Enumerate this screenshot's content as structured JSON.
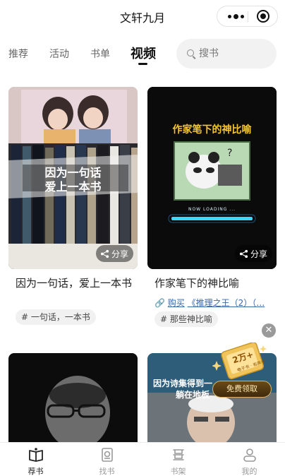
{
  "app": {
    "title": "文轩九月"
  },
  "tabs": [
    {
      "label": "推荐"
    },
    {
      "label": "活动"
    },
    {
      "label": "书单"
    },
    {
      "label": "视频"
    }
  ],
  "search": {
    "placeholder": "搜书"
  },
  "cards": [
    {
      "title": "因为一句话，爱上一本书",
      "image_caption_line1": "因为一句话",
      "image_caption_line2": "爱上一本书",
      "share_label": "分享",
      "tags": [
        "# 一句话，一本书"
      ]
    },
    {
      "title": "作家笔下的神比喻",
      "image_caption": "作家笔下的神比喻",
      "loading_text": "NOW LOADING ...",
      "share_label": "分享",
      "buy_prefix": "购买",
      "buy_title": "《推理之王（2）（…",
      "tags": [
        "# 那些神比喻"
      ]
    },
    {
      "title": ""
    },
    {
      "image_caption_line1": "因为诗集得到一",
      "image_caption_line2": "躺在地板"
    }
  ],
  "promo": {
    "coupon_value": "2万+",
    "coupon_sub": "电子书 · 有声书",
    "button_label": "免费领取",
    "close_symbol": "✕"
  },
  "bottom_nav": [
    {
      "label": "荐书",
      "icon": "open-book-icon",
      "active": true
    },
    {
      "label": "找书",
      "icon": "search-book-icon",
      "active": false
    },
    {
      "label": "书架",
      "icon": "bookshelf-icon",
      "active": false
    },
    {
      "label": "我的",
      "icon": "user-icon",
      "active": false
    }
  ],
  "colors": {
    "link": "#3a66a8",
    "active_text": "#222222",
    "inactive_text": "#999999",
    "accent_glow": "#3dd6ff"
  }
}
